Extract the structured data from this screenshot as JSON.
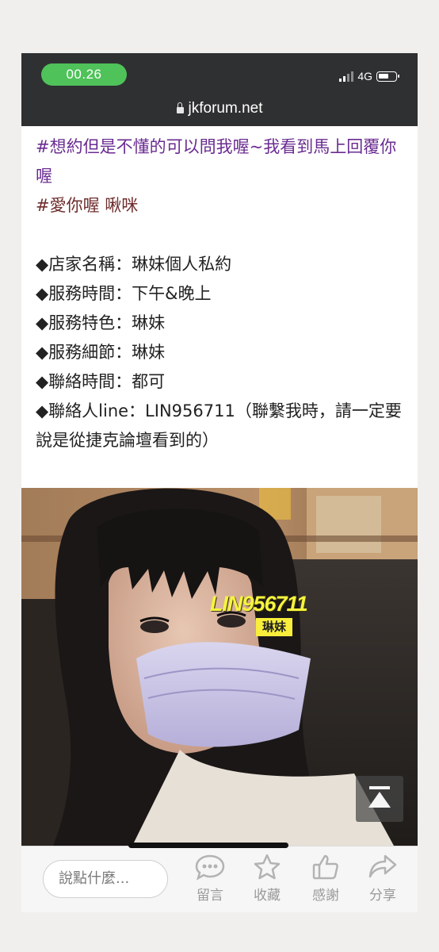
{
  "status_bar": {
    "time": "00.26",
    "network": "4G",
    "icons": [
      "signal-icon",
      "battery-icon"
    ]
  },
  "browser": {
    "url": "jkforum.net",
    "icons": [
      "lock-icon"
    ]
  },
  "post": {
    "tagline_1": "#想約但是不懂的可以問我喔~我看到馬上回覆你喔",
    "tagline_2": "#愛你喔 啾咪",
    "details": [
      "◆店家名稱：琳妹個人私約",
      "◆服務時間：下午&晚上",
      "◆服務特色：琳妹",
      "◆服務細節：琳妹",
      "◆聯絡時間：都可",
      "◆聯絡人line：LIN956711（聯繫我時，請一定要說是從捷克論壇看到的）"
    ]
  },
  "photo": {
    "watermark_id": "LIN956711",
    "watermark_name": "琳妹",
    "icons": [
      "scroll-to-top-icon"
    ]
  },
  "bottom_bar": {
    "comment_placeholder": "說點什麼...",
    "actions": [
      {
        "label": "留言",
        "icon": "comment-icon"
      },
      {
        "label": "收藏",
        "icon": "star-icon"
      },
      {
        "label": "感謝",
        "icon": "thumbs-up-icon"
      },
      {
        "label": "分享",
        "icon": "share-icon"
      }
    ]
  },
  "colors": {
    "status_green": "#4fc25a",
    "hashtag_purple": "#6a2c91",
    "hashtag_brown": "#6f2d2d",
    "watermark_yellow": "#f8ee3b",
    "chrome_dark": "#2f3031"
  }
}
